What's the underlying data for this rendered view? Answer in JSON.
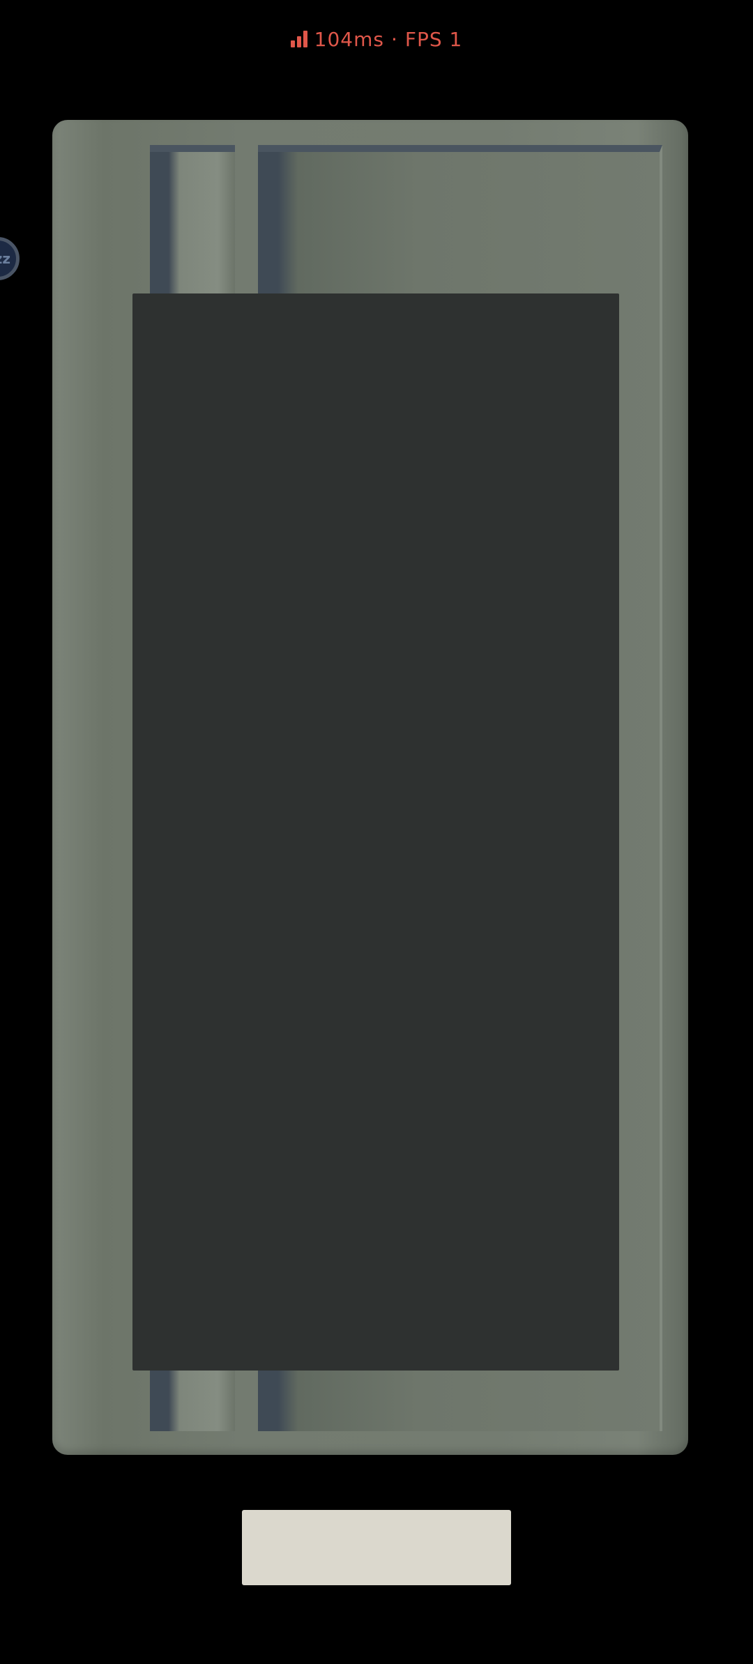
{
  "status": {
    "latency": "104ms",
    "separator": "·",
    "fps": "FPS 1",
    "color": "#e0574a",
    "icon": "signal-bars-icon"
  },
  "side_badge": {
    "text": "zz",
    "icon": "sleep-icon"
  },
  "board": {
    "frame_color": "#737b70",
    "slot_color": "#3f4a55",
    "overlay_color": "#2e3130"
  },
  "action_button": {
    "label": "",
    "color": "#dbd8cd"
  }
}
